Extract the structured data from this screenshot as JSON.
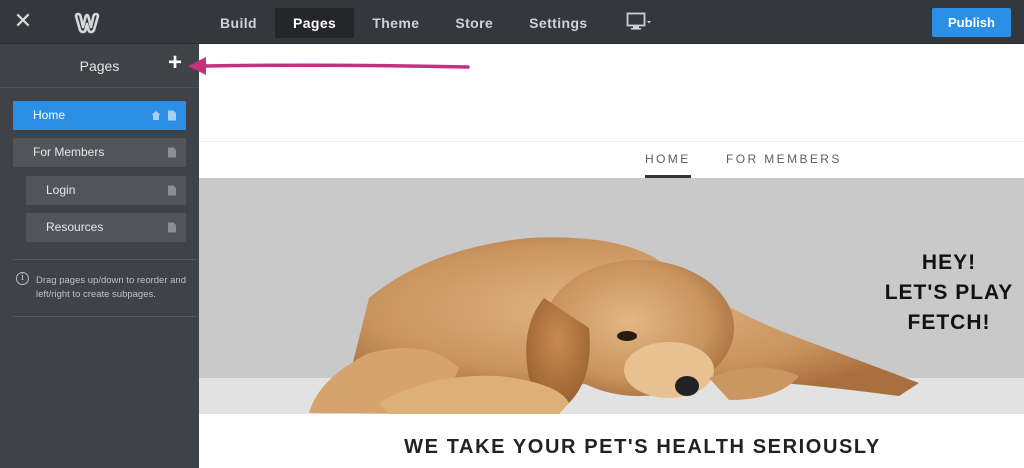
{
  "topbar": {
    "tabs": [
      {
        "label": "Build"
      },
      {
        "label": "Pages"
      },
      {
        "label": "Theme"
      },
      {
        "label": "Store"
      },
      {
        "label": "Settings"
      }
    ],
    "active_tab": "Pages",
    "publish_label": "Publish",
    "icons": {
      "close": "close-icon",
      "logo": "weebly-logo",
      "device": "desktop-device-icon"
    },
    "accent_color": "#2b8fe6"
  },
  "sidebar": {
    "title": "Pages",
    "add_symbol": "+",
    "pages": [
      {
        "label": "Home",
        "active": true,
        "level": 0
      },
      {
        "label": "For Members",
        "active": false,
        "level": 0
      },
      {
        "label": "Login",
        "active": false,
        "level": 1
      },
      {
        "label": "Resources",
        "active": false,
        "level": 1
      }
    ],
    "hint": "Drag pages up/down to reorder and left/right to create subpages."
  },
  "preview": {
    "nav": [
      "HOME",
      "FOR MEMBERS"
    ],
    "hero_lines": [
      "HEY!",
      "LET'S PLAY",
      "FETCH!"
    ],
    "headline": "WE TAKE YOUR PET'S HEALTH SERIOUSLY"
  },
  "annotation": {
    "arrow_color": "#c2307e"
  }
}
